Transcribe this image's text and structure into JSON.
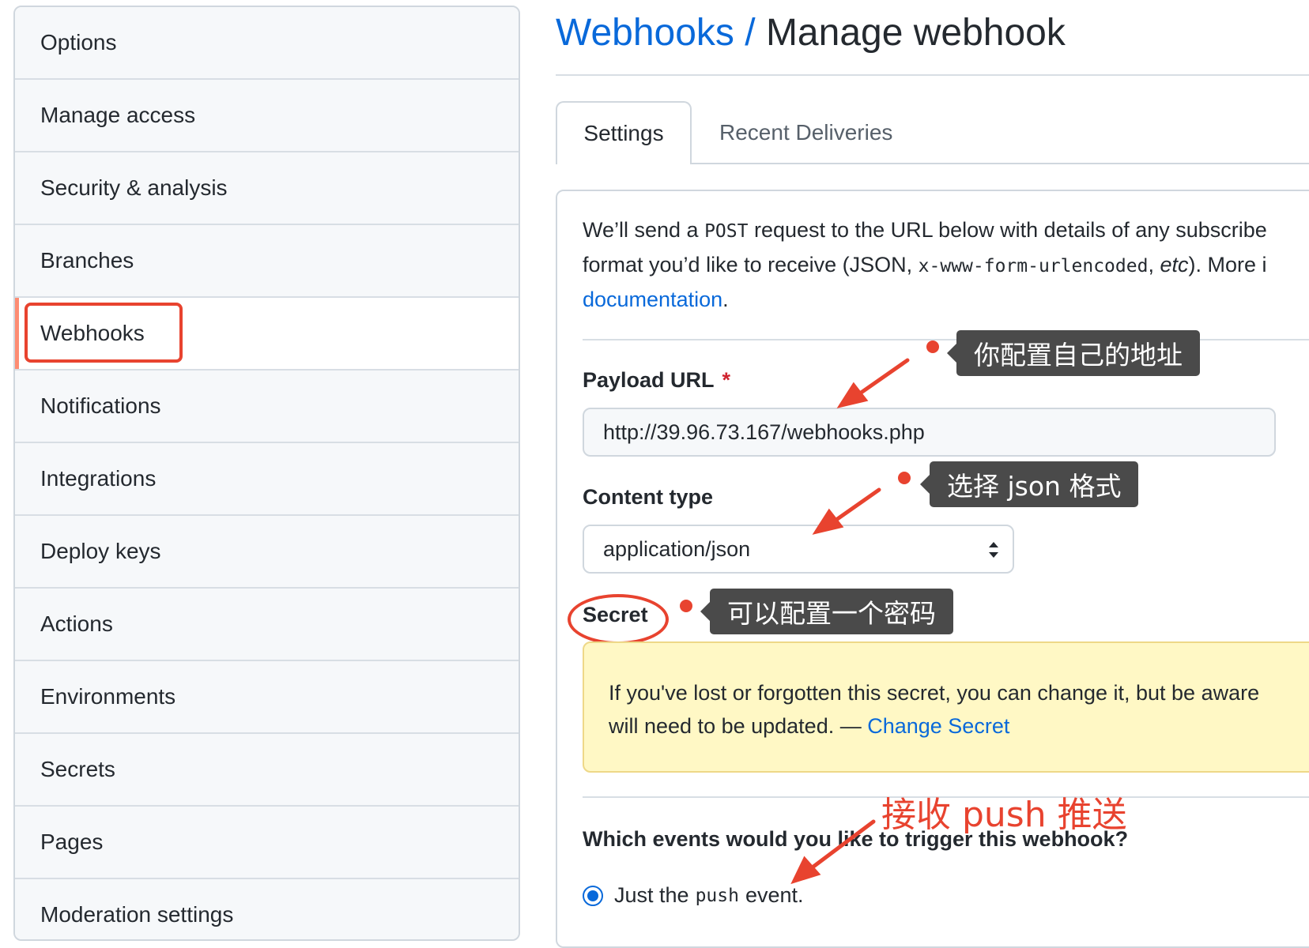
{
  "sidebar": {
    "items": [
      {
        "label": "Options"
      },
      {
        "label": "Manage access"
      },
      {
        "label": "Security & analysis"
      },
      {
        "label": "Branches"
      },
      {
        "label": "Webhooks"
      },
      {
        "label": "Notifications"
      },
      {
        "label": "Integrations"
      },
      {
        "label": "Deploy keys"
      },
      {
        "label": "Actions"
      },
      {
        "label": "Environments"
      },
      {
        "label": "Secrets"
      },
      {
        "label": "Pages"
      },
      {
        "label": "Moderation settings"
      }
    ],
    "active": "Webhooks"
  },
  "header": {
    "breadcrumb": "Webhooks",
    "separator": " / ",
    "title": "Manage webhook"
  },
  "tabs": [
    {
      "label": "Settings"
    },
    {
      "label": "Recent Deliveries"
    }
  ],
  "form": {
    "intro": {
      "part1": "We’ll send a ",
      "code1": "POST",
      "part2": " request to the URL below with details of any subscribe",
      "part3": "format you’d like to receive (JSON, ",
      "code2": "x-www-form-urlencoded",
      "part4": ", ",
      "em": "etc",
      "part5": "). More i",
      "link": "documentation",
      "part6": "."
    },
    "payload_url": {
      "label": "Payload URL",
      "required_mark": "*",
      "value": "http://39.96.73.167/webhooks.php"
    },
    "content_type": {
      "label": "Content type",
      "value": "application/json"
    },
    "secret": {
      "label": "Secret",
      "warning_line1": "If you've lost or forgotten this secret, you can change it, but be aware",
      "warning_line2": "will need to be updated. — ",
      "change_link": "Change Secret"
    },
    "events": {
      "question": "Which events would you like to trigger this webhook?",
      "option_pre": "Just the ",
      "option_code": "push",
      "option_post": " event."
    }
  },
  "annotations": {
    "payload_note": "你配置自己的地址",
    "content_note": "选择 json 格式",
    "secret_note": "可以配置一个密码",
    "push_note": "接收 push 推送",
    "color": "#e8432f"
  }
}
